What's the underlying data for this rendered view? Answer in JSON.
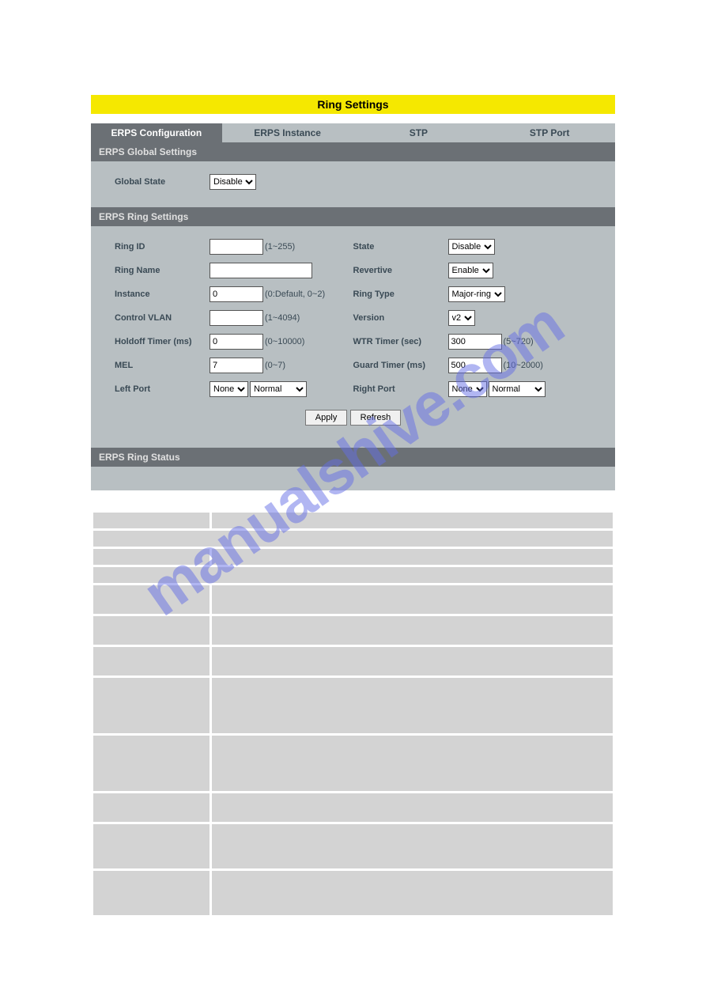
{
  "title": "Ring Settings",
  "tabs": {
    "erps_config": "ERPS Configuration",
    "erps_instance": "ERPS Instance",
    "stp": "STP",
    "stp_port": "STP Port"
  },
  "sections": {
    "global": "ERPS Global Settings",
    "ring": "ERPS Ring Settings",
    "status": "ERPS Ring Status"
  },
  "global": {
    "state_label": "Global State",
    "state_value": "Disable"
  },
  "ring": {
    "ring_id": {
      "label": "Ring ID",
      "value": "",
      "hint": "(1~255)"
    },
    "ring_name": {
      "label": "Ring Name",
      "value": ""
    },
    "instance": {
      "label": "Instance",
      "value": "0",
      "hint": "(0:Default, 0~2)"
    },
    "control_vlan": {
      "label": "Control VLAN",
      "value": "",
      "hint": "(1~4094)"
    },
    "holdoff": {
      "label": "Holdoff Timer (ms)",
      "value": "0",
      "hint": "(0~10000)"
    },
    "mel": {
      "label": "MEL",
      "value": "7",
      "hint": "(0~7)"
    },
    "left_port": {
      "label": "Left Port",
      "port": "None",
      "mode": "Normal"
    },
    "state": {
      "label": "State",
      "value": "Disable"
    },
    "revertive": {
      "label": "Revertive",
      "value": "Enable"
    },
    "ring_type": {
      "label": "Ring Type",
      "value": "Major-ring"
    },
    "version": {
      "label": "Version",
      "value": "v2"
    },
    "wtr": {
      "label": "WTR Timer (sec)",
      "value": "300",
      "hint": "(5~720)"
    },
    "guard": {
      "label": "Guard Timer (ms)",
      "value": "500",
      "hint": "(10~2000)"
    },
    "right_port": {
      "label": "Right Port",
      "port": "None",
      "mode": "Normal"
    }
  },
  "buttons": {
    "apply": "Apply",
    "refresh": "Refresh"
  },
  "watermark": "manualshive.com"
}
